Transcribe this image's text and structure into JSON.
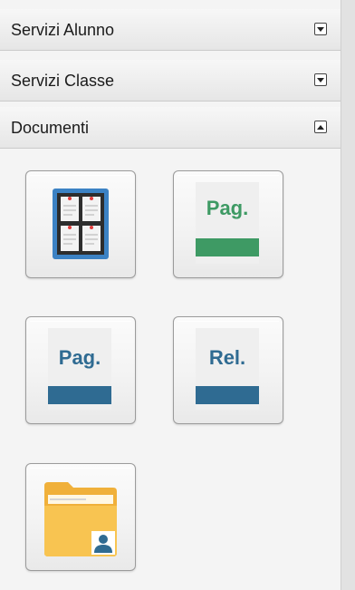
{
  "sections": [
    {
      "label": "Servizi Alunno",
      "state": "collapsed"
    },
    {
      "label": "Servizi Classe",
      "state": "collapsed"
    },
    {
      "label": "Documenti",
      "state": "expanded"
    }
  ],
  "tiles": [
    {
      "icon": "notice-board-icon"
    },
    {
      "icon": "green-page-icon",
      "text": "Pag.",
      "color": "#3e9a64"
    },
    {
      "icon": "blue-page-icon",
      "text": "Pag.",
      "color": "#2f6b92"
    },
    {
      "icon": "blue-report-icon",
      "text": "Rel.",
      "color": "#2f6b92"
    },
    {
      "icon": "user-folder-icon"
    }
  ]
}
